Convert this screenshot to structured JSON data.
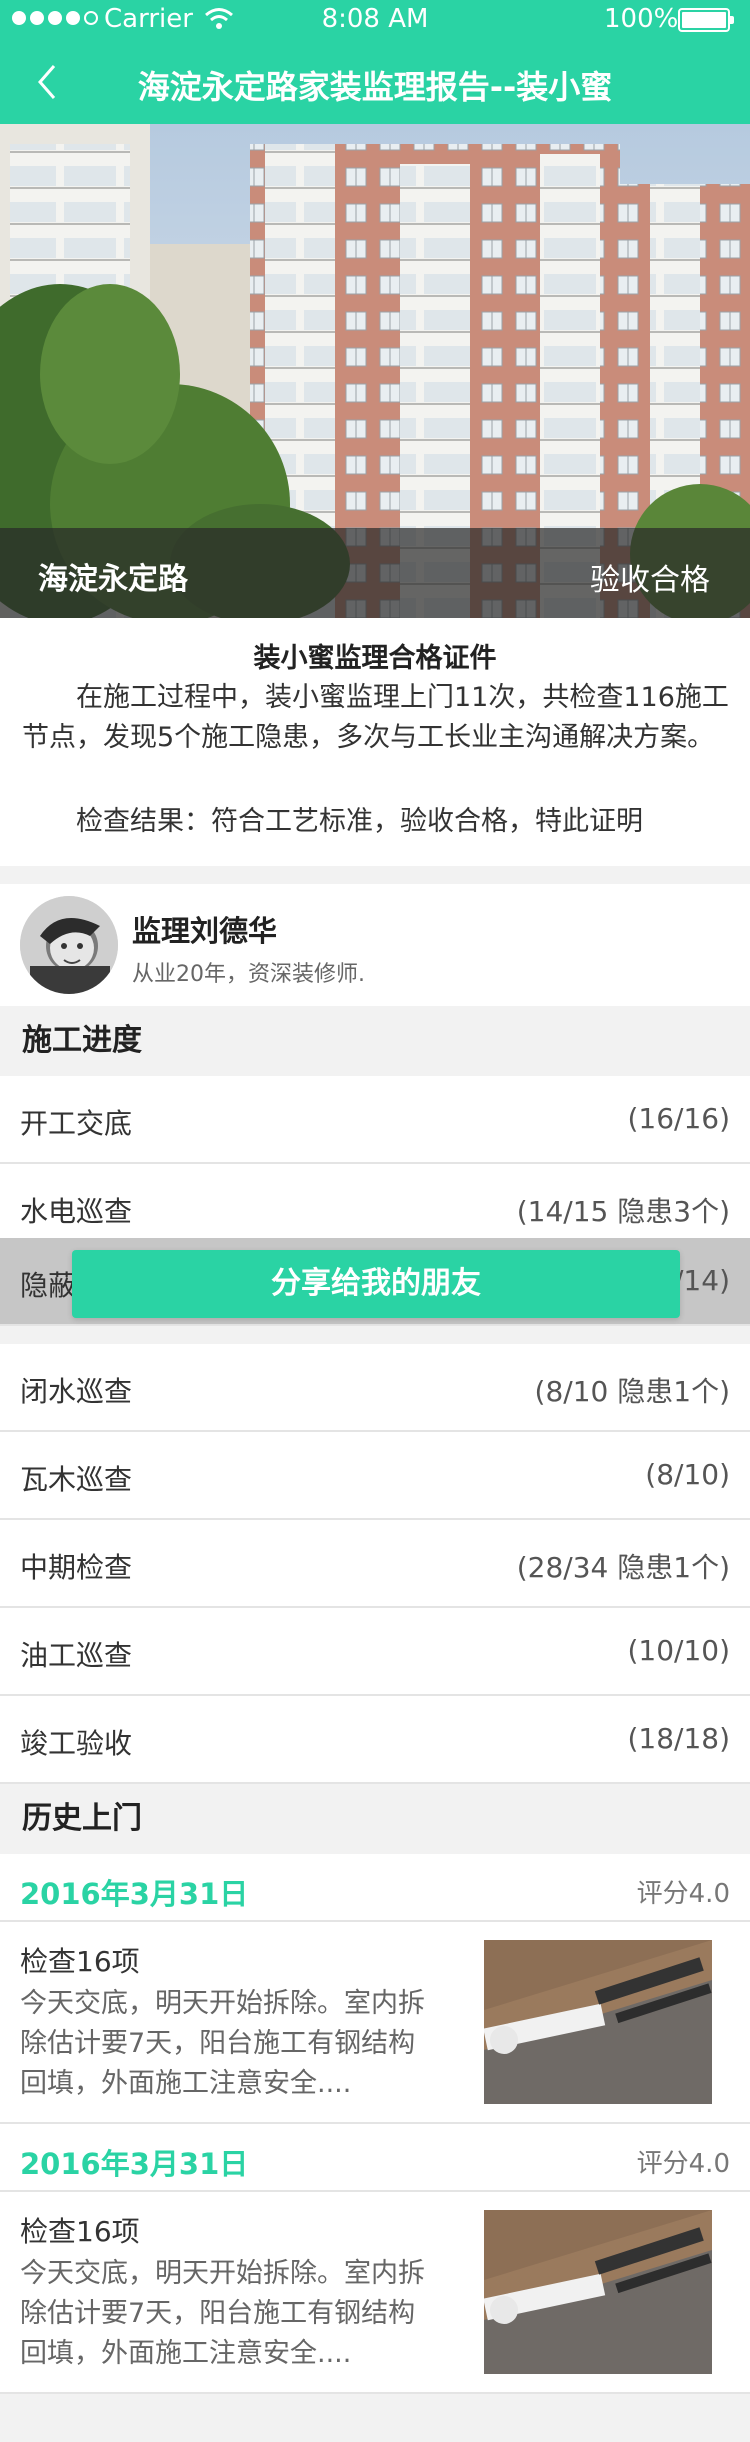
{
  "status_bar": {
    "carrier": "Carrier",
    "time": "8:08 AM",
    "battery": "100%"
  },
  "nav": {
    "title": "海淀永定路家装监理报告--装小蜜",
    "back_icon": "chevron-left-icon"
  },
  "hero": {
    "location": "海淀永定路",
    "status": "验收合格"
  },
  "certificate": {
    "title": "装小蜜监理合格证件",
    "body": "在施工过程中，装小蜜监理上门11次，共检查116施工节点，发现5个施工隐患，多次与工长业主沟通解决方案。",
    "result": "检查结果：符合工艺标准，验收合格，特此证明"
  },
  "supervisor": {
    "name": "监理刘德华",
    "desc": "从业20年，资深装修师."
  },
  "progress": {
    "header": "施工进度",
    "rows": [
      {
        "label": "开工交底",
        "value": "(16/16)"
      },
      {
        "label": "水电巡查",
        "value": "(14/15 隐患3个)"
      },
      {
        "label": "隐蔽",
        "value": "/14)"
      },
      {
        "label": "闭水巡查",
        "value": "(8/10 隐患1个)"
      },
      {
        "label": "瓦木巡查",
        "value": "(8/10)"
      },
      {
        "label": "中期检查",
        "value": "(28/34 隐患1个)"
      },
      {
        "label": "油工巡查",
        "value": "(10/10)"
      },
      {
        "label": "竣工验收",
        "value": "(18/18)"
      }
    ]
  },
  "share_button": "分享给我的朋友",
  "history": {
    "header": "历史上门",
    "visits": [
      {
        "date": "2016年3月31日",
        "score": "评分4.0",
        "title": "检查16项",
        "text": "今天交底，明天开始拆除。室内拆除估计要7天，阳台施工有钢结构回填，外面施工注意安全...."
      },
      {
        "date": "2016年3月31日",
        "score": "评分4.0",
        "title": "检查16项",
        "text": "今天交底，明天开始拆除。室内拆除估计要7天，阳台施工有钢结构回填，外面施工注意安全...."
      }
    ]
  },
  "colors": {
    "accent": "#2ad3a4",
    "background": "#f2f2f2"
  }
}
